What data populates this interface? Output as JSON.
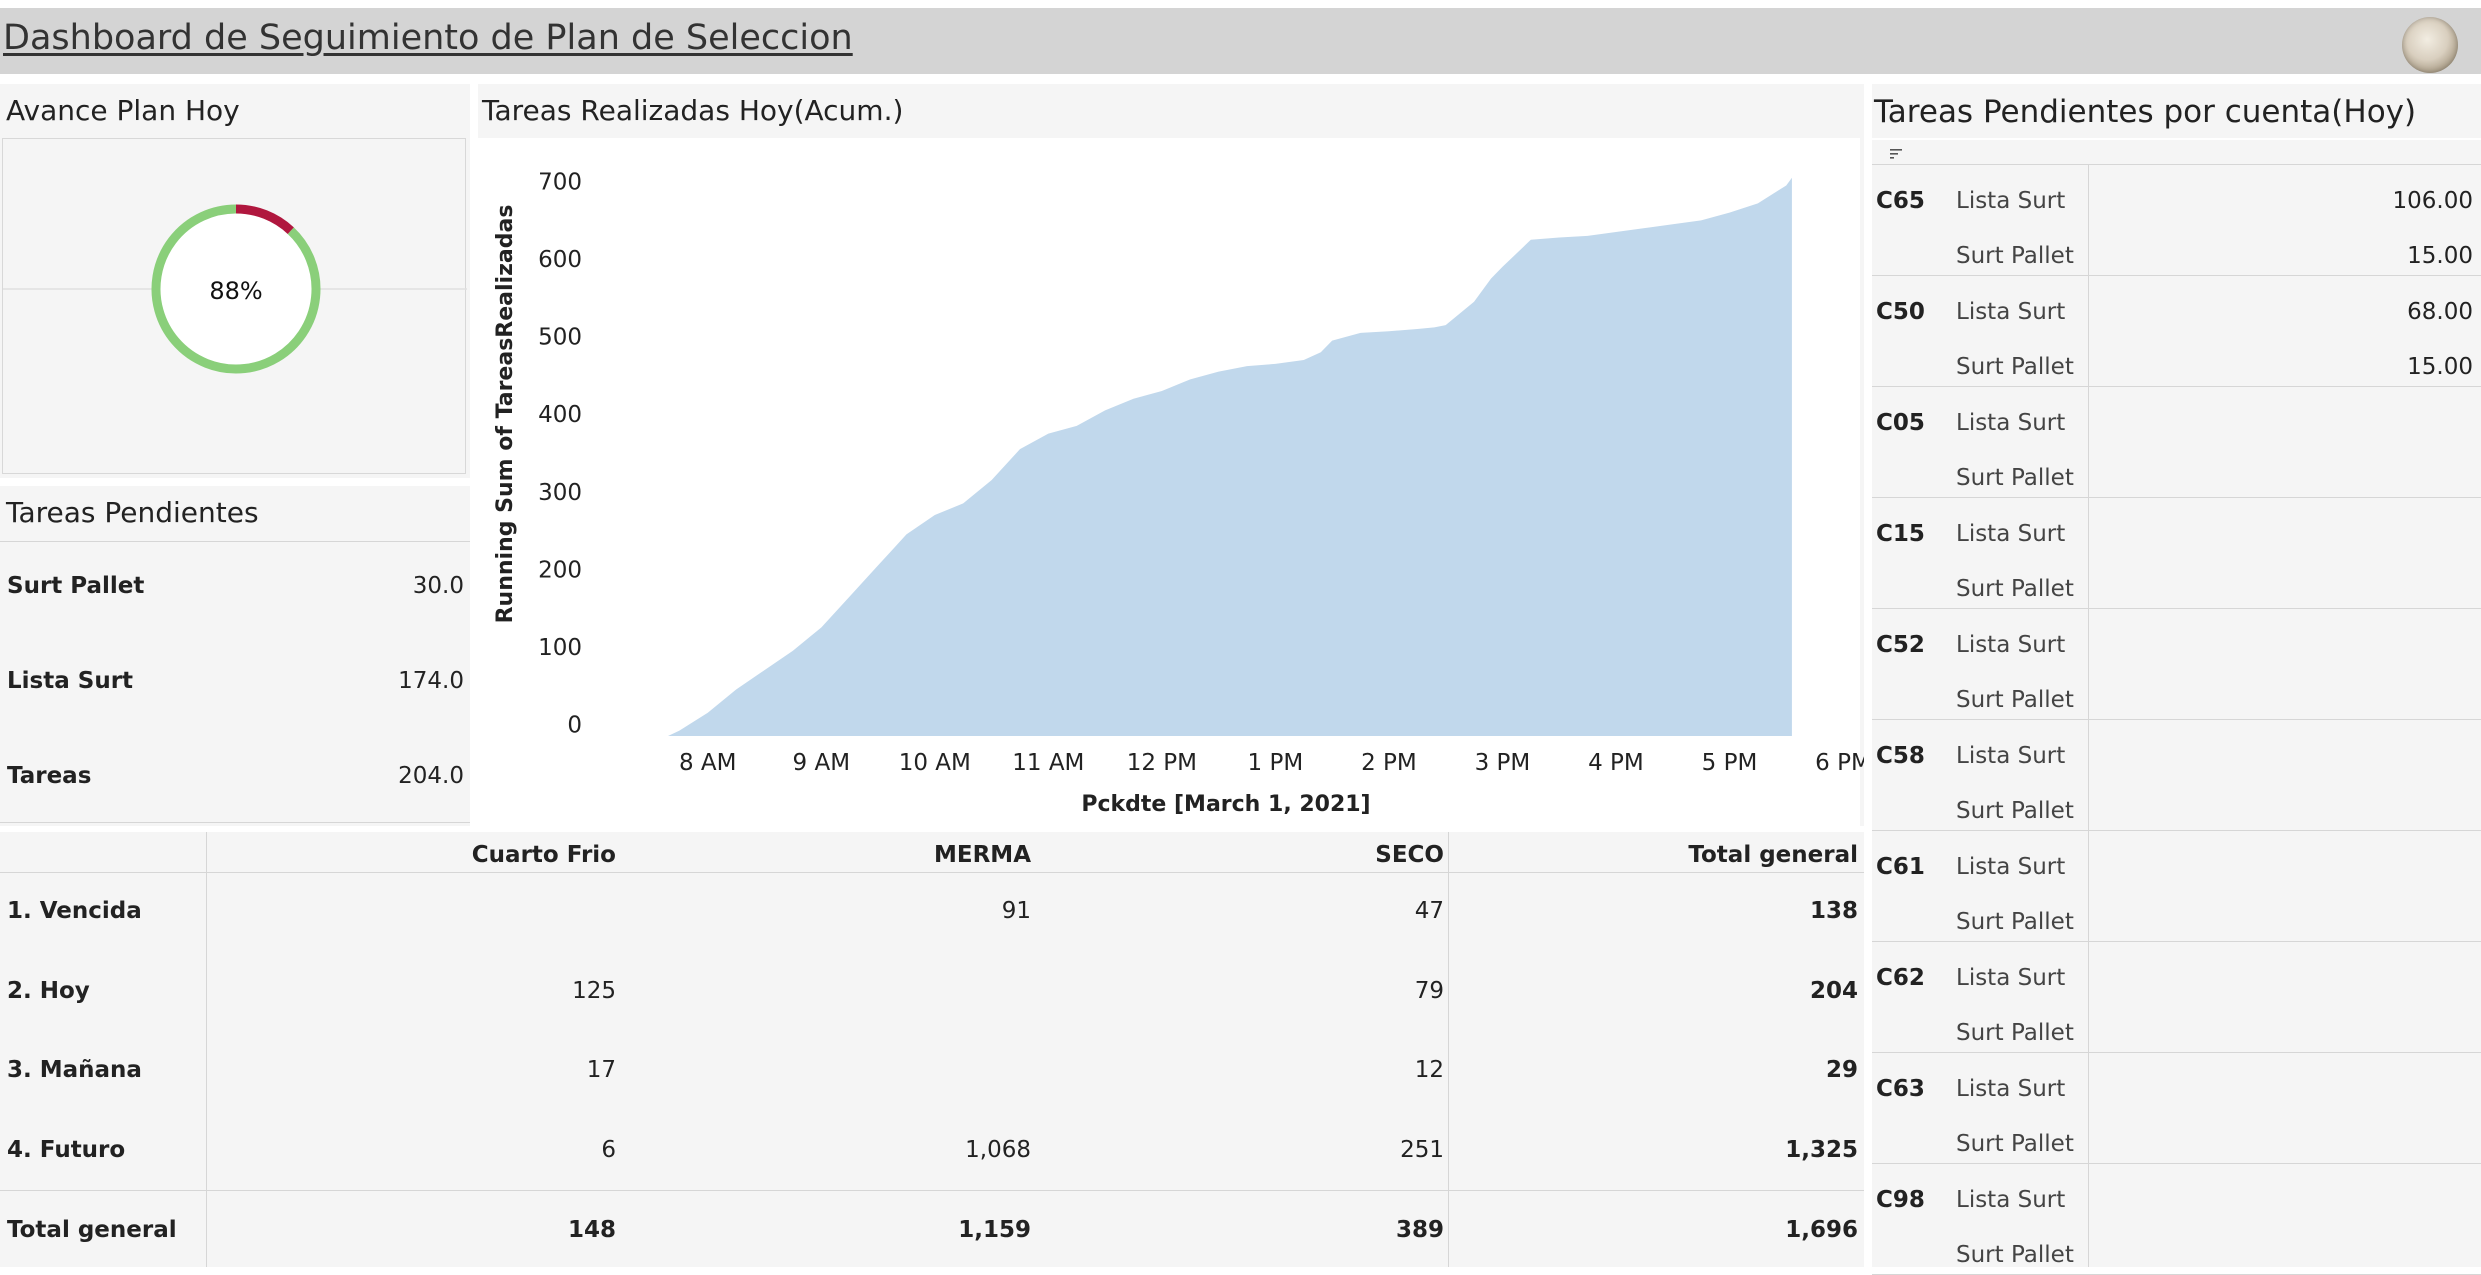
{
  "header": {
    "title": "Dashboard de Seguimiento de Plan de Seleccion",
    "logo_icon": "logo-icon"
  },
  "avance": {
    "title": "Avance Plan Hoy",
    "percent_label": "88%",
    "fraction": 0.88,
    "color_done": "#8acf7a",
    "color_remaining": "#b0173e"
  },
  "pendientes": {
    "title": "Tareas Pendientes",
    "rows": [
      {
        "label": "Surt Pallet",
        "value": "30.0"
      },
      {
        "label": "Lista Surt",
        "value": "174.0"
      },
      {
        "label": "Tareas",
        "value": "204.0"
      }
    ]
  },
  "chart": {
    "title": "Tareas Realizadas Hoy(Acum.)"
  },
  "chart_data": {
    "type": "area",
    "title": "Tareas Realizadas Hoy(Acum.)",
    "xlabel": "Pckdte [March 1, 2021]",
    "ylabel": "Running Sum of TareasRealizadas",
    "x_ticks": [
      "8 AM",
      "9 AM",
      "10 AM",
      "11 AM",
      "12 PM",
      "1 PM",
      "2 PM",
      "3 PM",
      "4 PM",
      "5 PM",
      "6 PM"
    ],
    "y_ticks": [
      "0",
      "100",
      "200",
      "300",
      "400",
      "500",
      "600",
      "700"
    ],
    "ylim": [
      -15,
      715
    ],
    "xlim": [
      7.5,
      18.0
    ],
    "grid": false,
    "color": "#c1d8ec",
    "series": [
      {
        "x": [
          7.65,
          7.75,
          8.0,
          8.25,
          8.5,
          8.75,
          9.0,
          9.25,
          9.5,
          9.75,
          10.0,
          10.25,
          10.5,
          10.75,
          11.0,
          11.25,
          11.5,
          11.75,
          12.0,
          12.25,
          12.5,
          12.75,
          13.0,
          13.25,
          13.4,
          13.5,
          13.75,
          14.0,
          14.25,
          14.4,
          14.5,
          14.75,
          14.9,
          15.0,
          15.25,
          15.5,
          15.75,
          16.0,
          16.25,
          16.5,
          16.75,
          17.0,
          17.25,
          17.5,
          17.55
        ],
        "y": [
          -15,
          -8,
          15,
          45,
          70,
          95,
          125,
          165,
          205,
          245,
          270,
          285,
          315,
          355,
          375,
          385,
          405,
          420,
          430,
          445,
          455,
          462,
          465,
          470,
          480,
          495,
          505,
          507,
          510,
          512,
          515,
          545,
          575,
          590,
          625,
          628,
          630,
          635,
          640,
          645,
          650,
          660,
          672,
          695,
          705
        ]
      }
    ]
  },
  "matrix": {
    "columns": [
      "Cuarto Frio",
      "MERMA",
      "SECO",
      "Total general"
    ],
    "rows": [
      {
        "label": "1. Vencida",
        "cells": [
          "",
          "91",
          "47",
          "138"
        ]
      },
      {
        "label": "2. Hoy",
        "cells": [
          "125",
          "",
          "79",
          "204"
        ]
      },
      {
        "label": "3. Mañana",
        "cells": [
          "17",
          "",
          "12",
          "29"
        ]
      },
      {
        "label": "4. Futuro",
        "cells": [
          "6",
          "1,068",
          "251",
          "1,325"
        ]
      },
      {
        "label": "Total general",
        "cells": [
          "148",
          "1,159",
          "389",
          "1,696"
        ]
      }
    ]
  },
  "cuentas": {
    "title": "Tareas Pendientes por cuenta(Hoy)",
    "sort_icon": "sort-icon",
    "accounts": [
      {
        "code": "C65",
        "rows": [
          {
            "type": "Lista Surt",
            "value": "106.00"
          },
          {
            "type": "Surt Pallet",
            "value": "15.00"
          }
        ]
      },
      {
        "code": "C50",
        "rows": [
          {
            "type": "Lista Surt",
            "value": "68.00"
          },
          {
            "type": "Surt Pallet",
            "value": "15.00"
          }
        ]
      },
      {
        "code": "C05",
        "rows": [
          {
            "type": "Lista Surt",
            "value": ""
          },
          {
            "type": "Surt Pallet",
            "value": ""
          }
        ]
      },
      {
        "code": "C15",
        "rows": [
          {
            "type": "Lista Surt",
            "value": ""
          },
          {
            "type": "Surt Pallet",
            "value": ""
          }
        ]
      },
      {
        "code": "C52",
        "rows": [
          {
            "type": "Lista Surt",
            "value": ""
          },
          {
            "type": "Surt Pallet",
            "value": ""
          }
        ]
      },
      {
        "code": "C58",
        "rows": [
          {
            "type": "Lista Surt",
            "value": ""
          },
          {
            "type": "Surt Pallet",
            "value": ""
          }
        ]
      },
      {
        "code": "C61",
        "rows": [
          {
            "type": "Lista Surt",
            "value": ""
          },
          {
            "type": "Surt Pallet",
            "value": ""
          }
        ]
      },
      {
        "code": "C62",
        "rows": [
          {
            "type": "Lista Surt",
            "value": ""
          },
          {
            "type": "Surt Pallet",
            "value": ""
          }
        ]
      },
      {
        "code": "C63",
        "rows": [
          {
            "type": "Lista Surt",
            "value": ""
          },
          {
            "type": "Surt Pallet",
            "value": ""
          }
        ]
      },
      {
        "code": "C98",
        "rows": [
          {
            "type": "Lista Surt",
            "value": ""
          },
          {
            "type": "Surt Pallet",
            "value": ""
          }
        ]
      }
    ]
  }
}
